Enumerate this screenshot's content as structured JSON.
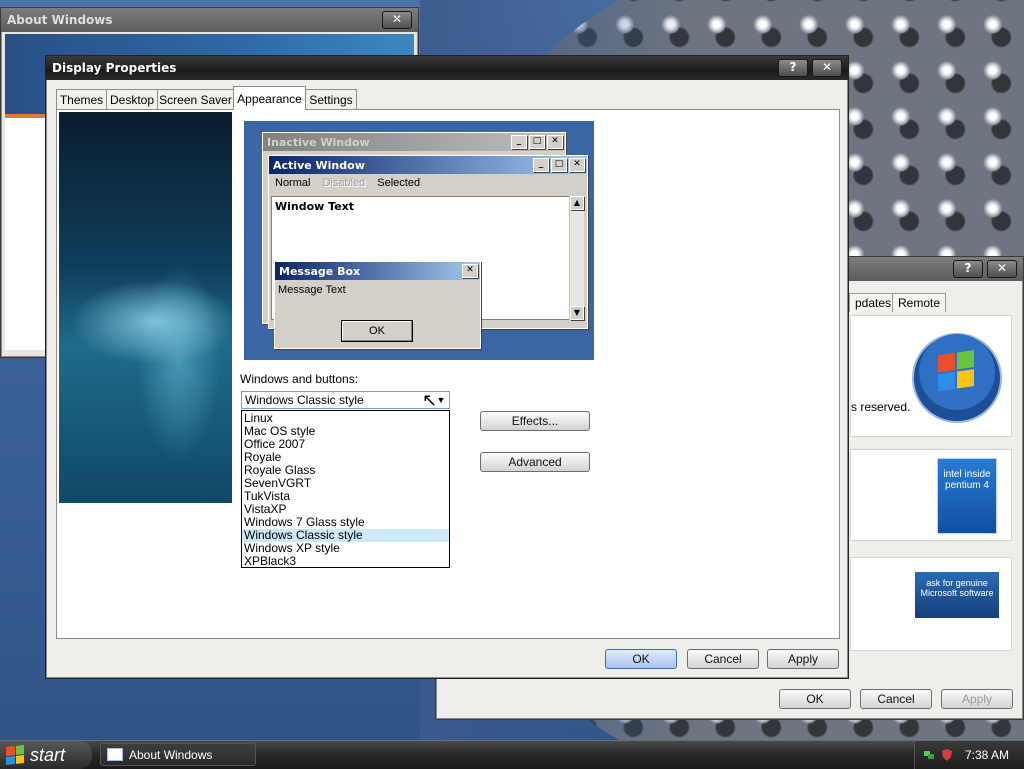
{
  "about_window": {
    "title": "About Windows"
  },
  "system_window": {
    "tabs": [
      "pdates",
      "Remote"
    ],
    "reserved_text": "s reserved.",
    "buttons": {
      "ok": "OK",
      "cancel": "Cancel",
      "apply": "Apply"
    },
    "intel_logo_text": "intel inside pentium 4",
    "genuine_logo_text": "ask for genuine Microsoft software"
  },
  "display_window": {
    "title": "Display Properties",
    "help_btn": "?",
    "close_btn": "✕",
    "tabs": [
      "Themes",
      "Desktop",
      "Screen Saver",
      "Appearance",
      "Settings"
    ],
    "selected_tab": "Appearance",
    "preview": {
      "inactive_title": "Inactive Window",
      "active_title": "Active Window",
      "menu": {
        "normal": "Normal",
        "disabled": "Disabled",
        "selected": "Selected"
      },
      "window_text": "Window Text",
      "message_title": "Message Box",
      "message_text": "Message Text",
      "message_ok": "OK"
    },
    "windows_buttons_label": "Windows and buttons:",
    "selected_style": "Windows Classic style",
    "style_options": [
      "Linux",
      "Mac OS style",
      "Office 2007",
      "Royale",
      "Royale Glass",
      "SevenVGRT",
      "TukVista",
      "VistaXP",
      "Windows 7 Glass style",
      "Windows Classic style",
      "Windows XP style",
      "XPBlack3"
    ],
    "effects_btn": "Effects...",
    "advanced_btn": "Advanced",
    "buttons": {
      "ok": "OK",
      "cancel": "Cancel",
      "apply": "Apply"
    }
  },
  "taskbar": {
    "start": "start",
    "task_about": "About Windows",
    "clock": "7:38 AM"
  }
}
